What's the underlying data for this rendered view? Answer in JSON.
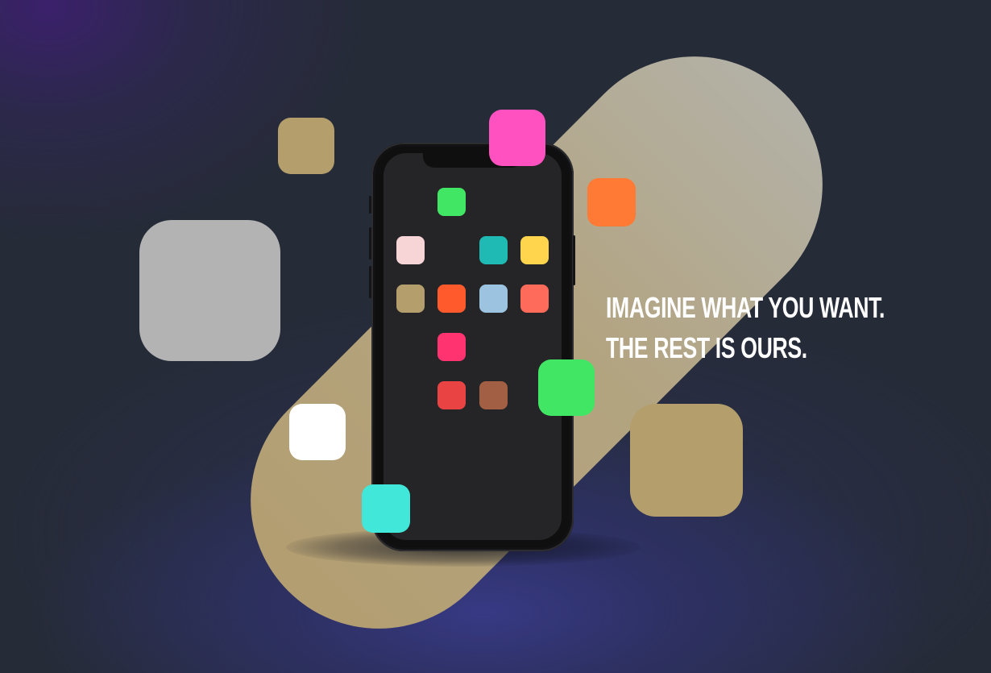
{
  "headline": {
    "line1": "IMAGINE WHAT YOU WANT.",
    "line2": "THE REST IS OURS."
  },
  "colors": {
    "background": "#262b38",
    "background_glow_blue": "#383a87",
    "background_glow_purple": "#3c206e",
    "band_start": "#b39e71",
    "band_end": "#b3b1a6",
    "phone_body": "#0f0f10",
    "phone_screen": "#252527",
    "text": "#ffffff"
  },
  "phone_apps": [
    {
      "name": "app-icon-green",
      "color": "#41e764"
    },
    {
      "name": "app-icon-pale-pink",
      "color": "#f7d4d6"
    },
    {
      "name": "app-icon-teal",
      "color": "#1fbab4"
    },
    {
      "name": "app-icon-yellow",
      "color": "#ffd54e"
    },
    {
      "name": "app-icon-tan",
      "color": "#b39e6c"
    },
    {
      "name": "app-icon-orange-red",
      "color": "#ff5a2b"
    },
    {
      "name": "app-icon-light-blue",
      "color": "#9cc3e0"
    },
    {
      "name": "app-icon-coral",
      "color": "#ff6b5a"
    },
    {
      "name": "app-icon-hot-pink",
      "color": "#ff3370"
    },
    {
      "name": "app-icon-red",
      "color": "#e94343"
    },
    {
      "name": "app-icon-brown",
      "color": "#a35f43"
    }
  ],
  "floating_tiles": [
    {
      "name": "floating-tile-gray",
      "color": "#b3b3b3"
    },
    {
      "name": "floating-tile-tan-small",
      "color": "#b39e6c"
    },
    {
      "name": "floating-tile-magenta",
      "color": "#ff51c0"
    },
    {
      "name": "floating-tile-orange",
      "color": "#ff7b35"
    },
    {
      "name": "floating-tile-green",
      "color": "#41e764"
    },
    {
      "name": "floating-tile-white",
      "color": "#ffffff"
    },
    {
      "name": "floating-tile-cyan",
      "color": "#41e8d9"
    },
    {
      "name": "floating-tile-tan-large",
      "color": "#b39e6c"
    }
  ]
}
